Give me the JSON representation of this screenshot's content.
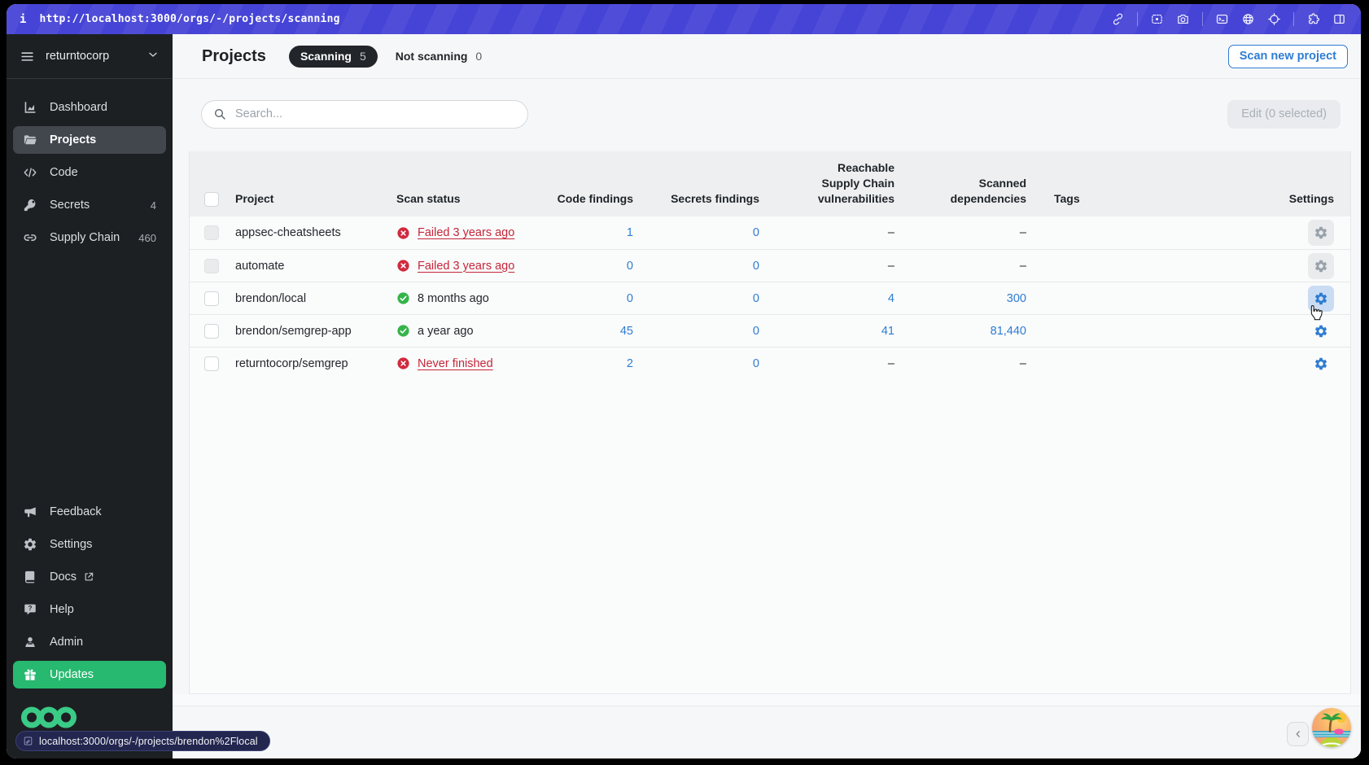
{
  "browser": {
    "info_icon": "i",
    "url": "http://localhost:3000/orgs/-/projects/scanning",
    "icons": [
      "link-icon",
      "screenshot-icon",
      "camera-icon",
      "terminal-icon",
      "globe-icon",
      "crosshair-icon",
      "extensions-icon",
      "split-view-icon"
    ]
  },
  "sidebar": {
    "org_name": "returntocorp",
    "nav": [
      {
        "label": "Dashboard",
        "icon": "dashboard-icon",
        "badge": "",
        "active": false
      },
      {
        "label": "Projects",
        "icon": "projects-icon",
        "badge": "",
        "active": true
      },
      {
        "label": "Code",
        "icon": "code-icon",
        "badge": "",
        "active": false
      },
      {
        "label": "Secrets",
        "icon": "secrets-icon",
        "badge": "4",
        "active": false
      },
      {
        "label": "Supply Chain",
        "icon": "supply-chain-icon",
        "badge": "460",
        "active": false
      }
    ],
    "nav_bottom": [
      {
        "label": "Feedback",
        "icon": "feedback-icon",
        "external": false,
        "highlight": false
      },
      {
        "label": "Settings",
        "icon": "settings-icon",
        "external": false,
        "highlight": false
      },
      {
        "label": "Docs",
        "icon": "docs-icon",
        "external": true,
        "highlight": false
      },
      {
        "label": "Help",
        "icon": "help-icon",
        "external": false,
        "highlight": false
      },
      {
        "label": "Admin",
        "icon": "admin-icon",
        "external": false,
        "highlight": false
      },
      {
        "label": "Updates",
        "icon": "updates-icon",
        "external": false,
        "highlight": true
      }
    ],
    "logo": "semgrep-logo"
  },
  "header": {
    "title": "Projects",
    "tabs": [
      {
        "label": "Scanning",
        "count": "5",
        "active": true
      },
      {
        "label": "Not scanning",
        "count": "0",
        "active": false
      }
    ],
    "primary_button": "Scan new project"
  },
  "toolbar": {
    "search_placeholder": "Search...",
    "edit_button": "Edit (0 selected)"
  },
  "table": {
    "columns": [
      "Project",
      "Scan status",
      "Code findings",
      "Secrets findings",
      "Reachable Supply Chain vulnerabilities",
      "Scanned dependencies",
      "Tags",
      "Settings"
    ],
    "rows": [
      {
        "project": "appsec-cheatsheets",
        "status_text": "Failed 3 years ago",
        "status": "failed",
        "code_findings": "1",
        "secrets_findings": "0",
        "reachable_vulns": "–",
        "scanned_deps": "–",
        "tags": "",
        "muted": true,
        "gear_hover": false
      },
      {
        "project": "automate",
        "status_text": "Failed 3 years ago",
        "status": "failed",
        "code_findings": "0",
        "secrets_findings": "0",
        "reachable_vulns": "–",
        "scanned_deps": "–",
        "tags": "",
        "muted": true,
        "gear_hover": false
      },
      {
        "project": "brendon/local",
        "status_text": "8 months ago",
        "status": "success",
        "code_findings": "0",
        "secrets_findings": "0",
        "reachable_vulns": "4",
        "scanned_deps": "300",
        "tags": "",
        "muted": false,
        "gear_hover": true
      },
      {
        "project": "brendon/semgrep-app",
        "status_text": "a year ago",
        "status": "success",
        "code_findings": "45",
        "secrets_findings": "0",
        "reachable_vulns": "41",
        "scanned_deps": "81,440",
        "tags": "",
        "muted": false,
        "gear_hover": false
      },
      {
        "project": "returntocorp/semgrep",
        "status_text": "Never finished",
        "status": "failed",
        "code_findings": "2",
        "secrets_findings": "0",
        "reachable_vulns": "–",
        "scanned_deps": "–",
        "tags": "",
        "muted": false,
        "gear_hover": false
      }
    ]
  },
  "statusbar": {
    "link_preview": "localhost:3000/orgs/-/projects/brendon%2Flocal"
  },
  "colors": {
    "accent_blue": "#2e7cd3",
    "failed_red": "#c5273a",
    "success_green": "#35b44a",
    "updates_green": "#27b96f",
    "topbar_indigo": "#4644d6"
  }
}
